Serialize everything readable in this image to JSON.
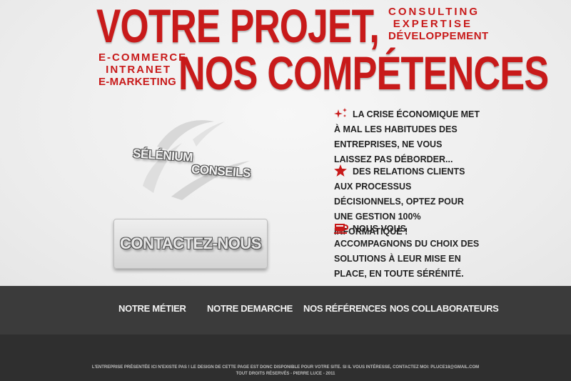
{
  "headline": {
    "line1": "VOTRE PROJET,",
    "line2": "NOS COMPÉTENCES"
  },
  "services_right": [
    "CONSULTING",
    "EXPERTISE",
    "DÉVELOPPEMENT"
  ],
  "services_left": [
    "E-COMMERCE",
    "INTRANET",
    "E-MARKETING"
  ],
  "logo": {
    "word1": "SÉLÉNIUM",
    "word2": "CONSEILS"
  },
  "contact_button": {
    "label": "CONTACTEZ-NOUS"
  },
  "features": [
    {
      "icon": "sparkles-icon",
      "text": "LA CRISE ÉCONOMIQUE MET À MAL LES HABITUDES DES ENTREPRISES, NE VOUS LAISSEZ PAS DÉBORDER..."
    },
    {
      "icon": "star-icon",
      "text": "DES RELATIONS CLIENTS AUX PROCESSUS DÉCISIONNELS, OPTEZ POUR UNE GESTION 100% INFORMATIQUE !"
    },
    {
      "icon": "coffee-cup-icon",
      "text": "NOUS VOUS ACCOMPAGNONS DU CHOIX DES SOLUTIONS À LEUR MISE EN PLACE, EN TOUTE SÉRÉNITÉ."
    }
  ],
  "nav": {
    "items": [
      "NOTRE MÉTIER",
      "NOTRE DEMARCHE",
      "NOS RÉFÉRENCES",
      "NOS COLLABORATEURS"
    ]
  },
  "footer": {
    "line1": "L'ENTREPRISE PRÉSENTÉE ICI N'EXISTE PAS ! LE DESIGN DE CETTE PAGE EST DONC DISPONIBLE POUR VOTRE SITE. SI IL VOUS INTÉRESSE, CONTACTEZ MOI: PLUCE18@GMAIL.COM",
    "line2": "TOUT DROITS RÉSERVÉS - PIERRE LUCE - 2011"
  },
  "colors": {
    "accent": "#c81a1a",
    "nav_bg": "#3b3b3b",
    "footer_bg": "#2f2f2f",
    "page_bg": "#efefef"
  }
}
